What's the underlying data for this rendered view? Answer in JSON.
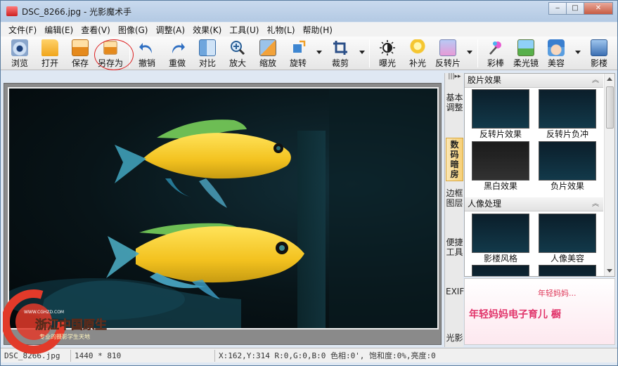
{
  "window": {
    "title": "DSC_8266.jpg - 光影魔术手",
    "min": "‒",
    "max": "□",
    "close": "✕"
  },
  "menu": [
    "文件(F)",
    "编辑(E)",
    "查看(V)",
    "图像(G)",
    "调整(A)",
    "效果(K)",
    "工具(U)",
    "礼物(L)",
    "帮助(H)"
  ],
  "toolbar": {
    "browse": "浏览",
    "open": "打开",
    "save": "保存",
    "save_as": "另存为",
    "undo": "撤销",
    "redo": "重做",
    "compare": "对比",
    "zoom_in": "放大",
    "resize": "缩放",
    "rotate": "旋转",
    "crop": "裁剪",
    "exposure": "曝光",
    "fill_light": "补光",
    "reverse": "反转片",
    "color_pencil": "彩棒",
    "soft_focus": "柔光镜",
    "beauty": "美容",
    "studio": "影楼"
  },
  "side_tabs": {
    "basic": "基本调整",
    "darkroom": "数码暗房",
    "frame": "边框图层",
    "tools": "便捷工具",
    "exif": "EXIF",
    "light": "光影"
  },
  "panel": {
    "section1": "胶片效果",
    "effects1": [
      "反转片效果",
      "反转片负冲",
      "黑白效果",
      "负片效果"
    ],
    "section2": "人像处理",
    "effects2": [
      "影楼风格",
      "人像美容"
    ]
  },
  "ad": {
    "small": "年轻妈妈...",
    "main": "年轻妈妈电子育儿 橱"
  },
  "status": {
    "file": "DSC_8266.jpg",
    "size": "1440 * 810",
    "info": "X:162,Y:314 R:0,G:0,B:0 色相:0', 饱和度:0%,亮度:0"
  },
  "watermark": {
    "brand": "浙江中国原生",
    "url": "WWW.CGHZD.COM",
    "slogan": "专业的摄影学生天地"
  }
}
